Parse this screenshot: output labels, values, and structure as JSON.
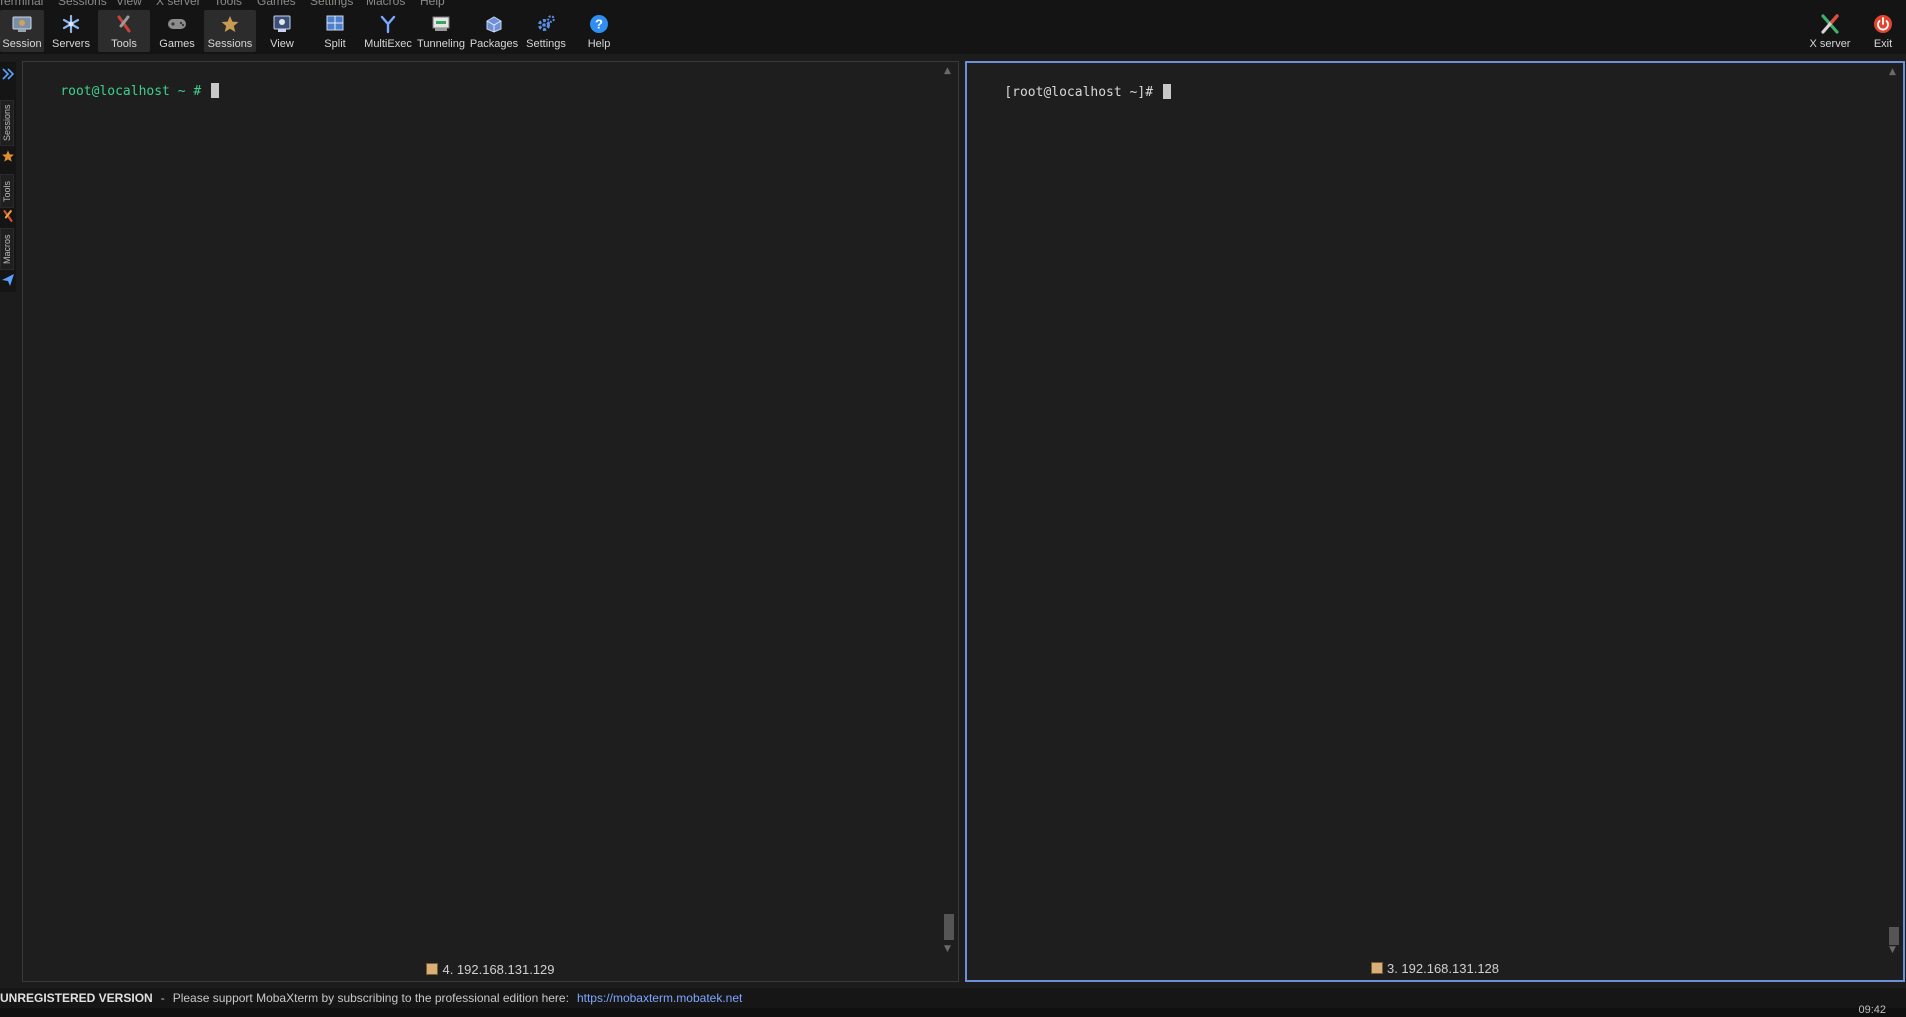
{
  "menu": [
    "Terminal",
    "Sessions",
    "View",
    "X server",
    "Tools",
    "Games",
    "Settings",
    "Macros",
    "Help"
  ],
  "toolbar": {
    "session": "Session",
    "servers": "Servers",
    "tools": "Tools",
    "games": "Games",
    "sessions": "Sessions",
    "view": "View",
    "split": "Split",
    "multiexec": "MultiExec",
    "tunneling": "Tunneling",
    "packages": "Packages",
    "settings": "Settings",
    "help": "Help",
    "xserver": "X server",
    "exit": "Exit"
  },
  "sidetabs": {
    "sessions": "Sessions",
    "tools": "Tools",
    "macros": "Macros"
  },
  "panes": {
    "left": {
      "prompt_user": "root@localhost",
      "prompt_rest": " ~ # ",
      "status": "4. 192.168.131.129"
    },
    "right": {
      "prompt": "[root@localhost ~]# ",
      "status": "3. 192.168.131.128"
    }
  },
  "bottom": {
    "unregistered": "UNREGISTERED VERSION",
    "separator": "-",
    "message": "Please support MobaXterm by subscribing to the professional edition here:",
    "link": "https://mobaxterm.mobatek.net"
  },
  "taskbar": {
    "time": "09:42"
  },
  "colors": {
    "prompt_green": "#3fcf8e",
    "accent_blue": "#6d8fd6",
    "link_blue": "#7fa6ff"
  }
}
